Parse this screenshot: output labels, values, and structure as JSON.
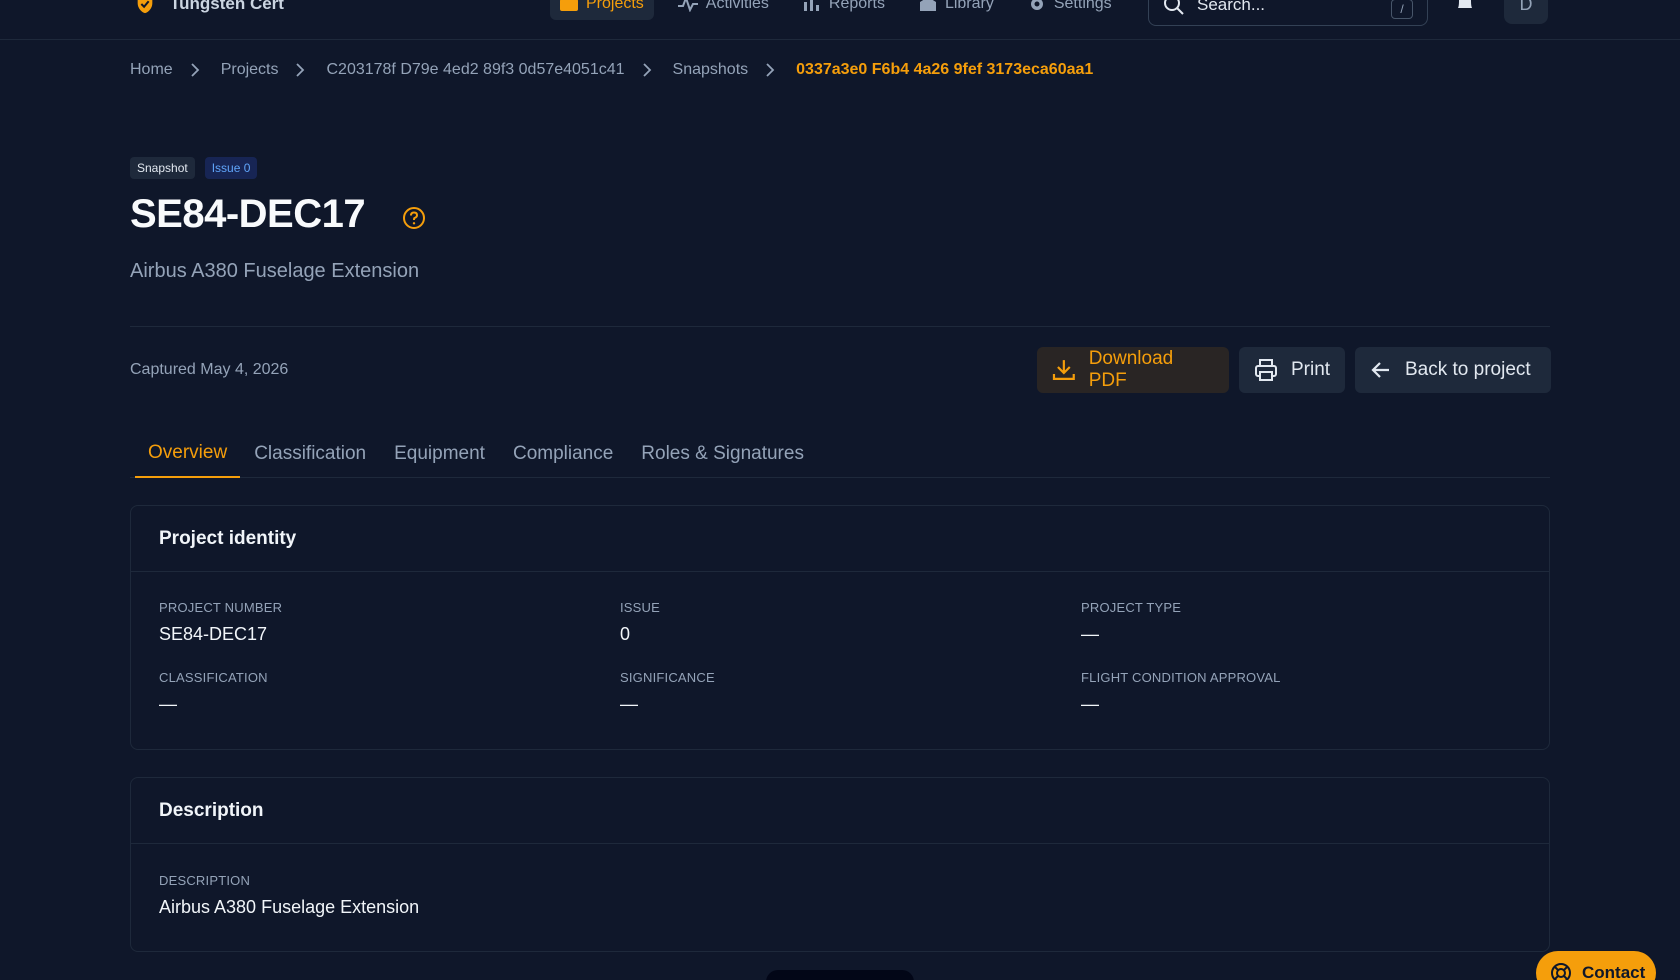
{
  "app": {
    "name": "Tungsten Cert",
    "nav": [
      {
        "label": "Projects",
        "active": true
      },
      {
        "label": "Activities"
      },
      {
        "label": "Reports"
      },
      {
        "label": "Library"
      },
      {
        "label": "Settings"
      }
    ],
    "search": {
      "placeholder": "Search...",
      "shortcut": "/"
    },
    "avatar_initial": "D"
  },
  "breadcrumb": [
    "Home",
    "Projects",
    "C203178f D79e 4ed2 89f3 0d57e4051c41",
    "Snapshots",
    "0337a3e0 F6b4 4a26 9fef 3173eca60aa1"
  ],
  "header": {
    "badges": [
      "Snapshot",
      "Issue 0"
    ],
    "title": "SE84-DEC17",
    "subtitle": "Airbus A380 Fuselage Extension",
    "captured": "Captured May 4, 2026"
  },
  "actions": {
    "download": "Download PDF",
    "print": "Print",
    "back": "Back to project"
  },
  "tabs": [
    "Overview",
    "Classification",
    "Equipment",
    "Compliance",
    "Roles & Signatures"
  ],
  "identity": {
    "title": "Project identity",
    "fields": [
      {
        "label": "PROJECT NUMBER",
        "value": "SE84-DEC17"
      },
      {
        "label": "ISSUE",
        "value": "0"
      },
      {
        "label": "PROJECT TYPE",
        "value": "—"
      },
      {
        "label": "CLASSIFICATION",
        "value": "—"
      },
      {
        "label": "SIGNIFICANCE",
        "value": "—"
      },
      {
        "label": "FLIGHT CONDITION APPROVAL",
        "value": "—"
      }
    ]
  },
  "description": {
    "title": "Description",
    "label": "DESCRIPTION",
    "value": "Airbus A380 Fuselage Extension"
  },
  "contact": {
    "label": "Contact"
  },
  "colors": {
    "background": "#0f172a",
    "accent": "#f59e0b",
    "border": "#1e293b"
  }
}
